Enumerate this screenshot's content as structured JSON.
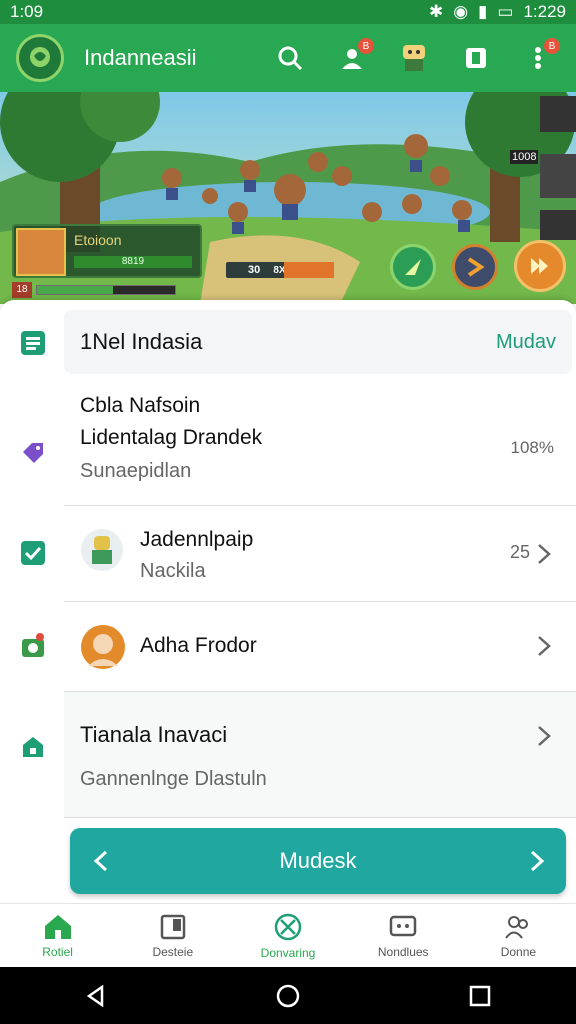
{
  "status": {
    "time": "1:09",
    "clock_right": "1:229"
  },
  "appbar": {
    "title": "Indanneasii",
    "badge_left": "B",
    "badge_right": "B"
  },
  "banner": {
    "player_name": "Etoioon",
    "player_bar_text": "8819",
    "level": "18",
    "progress": 0.55,
    "mid_count": "30",
    "mid_bar_text": "8X8",
    "side_text": "1008"
  },
  "header_row": {
    "title": "1Nel Indasia",
    "action": "Mudav"
  },
  "rows": [
    {
      "line1": "Cbla Nafsoin",
      "line2": "Lidentalag Drandek",
      "sub": "Sunaepidlan",
      "value": "108%"
    },
    {
      "line1": "Jadennlpaip",
      "sub": "Nackila",
      "value": "25"
    },
    {
      "line1": "Adha Frodor"
    },
    {
      "line1": "Tianala Inavaci",
      "sub": "Gannenlnge Dlastuln"
    }
  ],
  "nav_button": {
    "label": "Mudesk"
  },
  "tabs": [
    {
      "label": "Rotiel",
      "icon": "home-icon"
    },
    {
      "label": "Desteie",
      "icon": "book-icon"
    },
    {
      "label": "Donvaring",
      "icon": "cancel-circle-icon"
    },
    {
      "label": "Nondlues",
      "icon": "message-icon"
    },
    {
      "label": "Donne",
      "icon": "people-icon"
    }
  ],
  "colors": {
    "primary": "#28a852",
    "teal": "#1fa7a0",
    "accent": "#1e9e77"
  }
}
